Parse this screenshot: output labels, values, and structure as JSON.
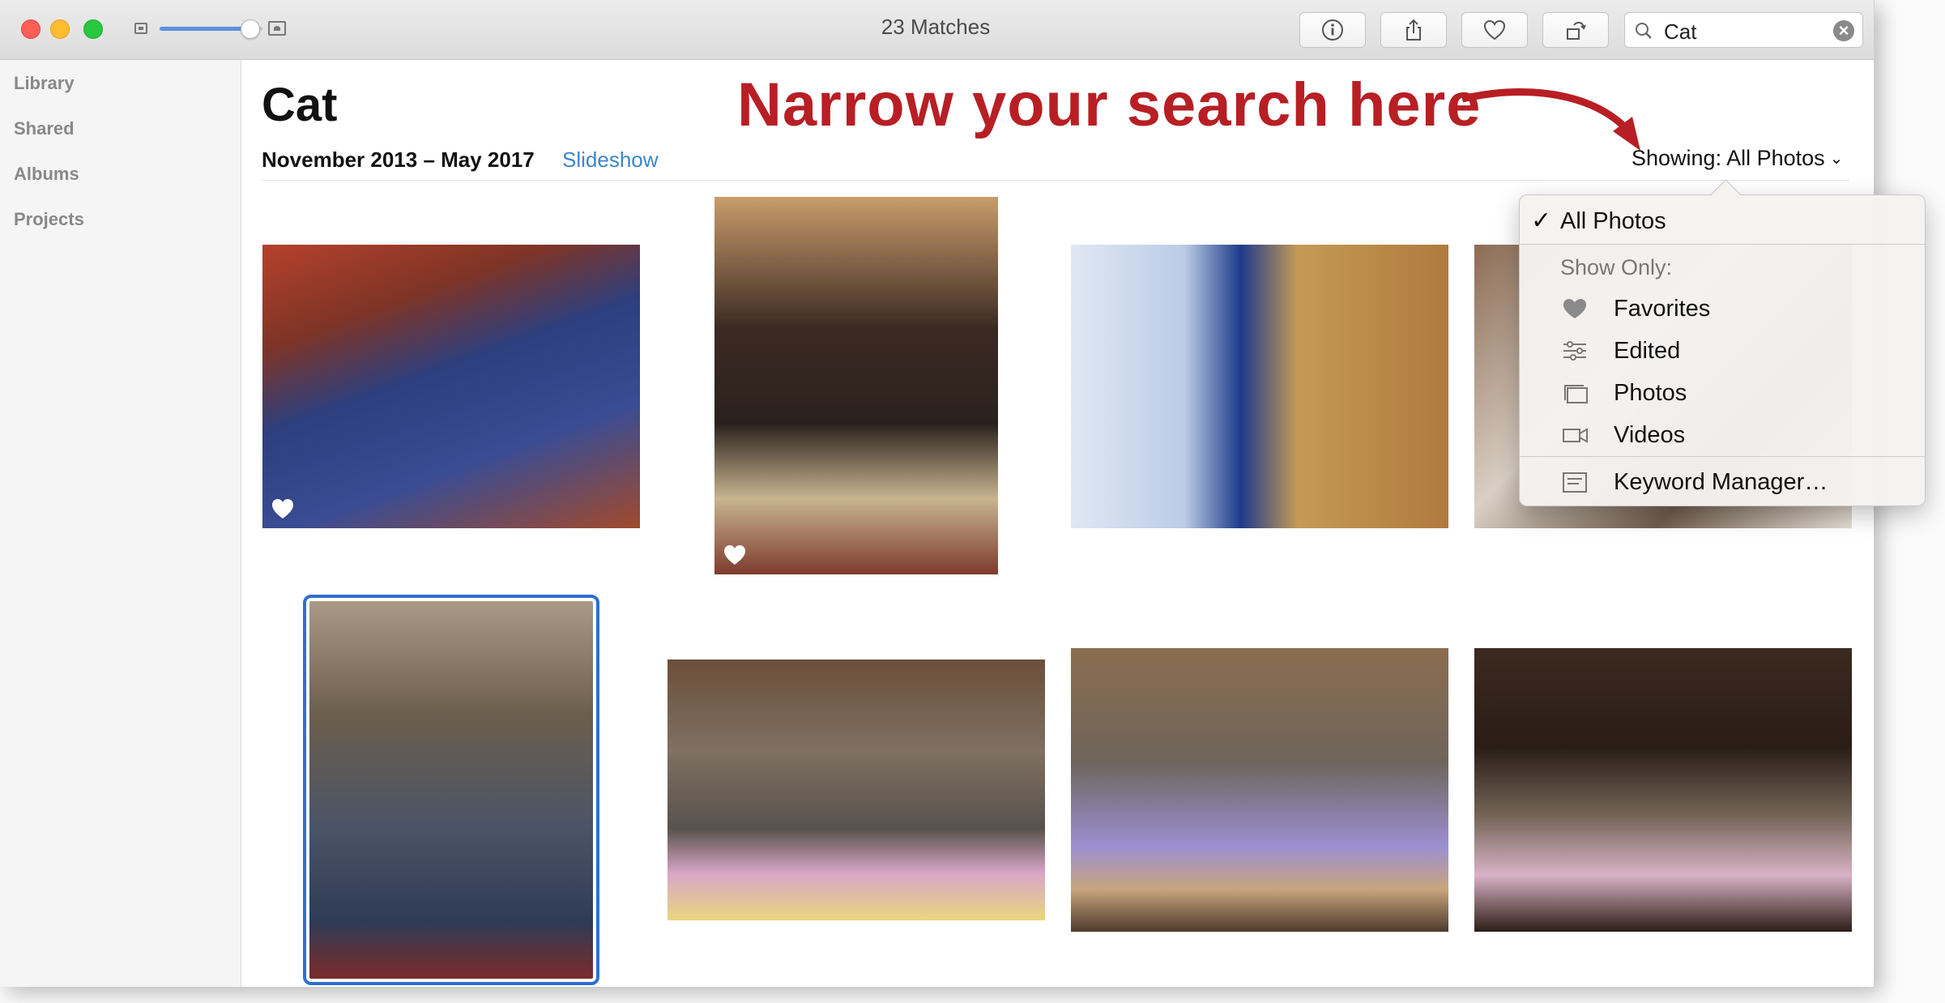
{
  "window": {
    "title": "23 Matches"
  },
  "toolbar": {
    "buttons": [
      "info-icon",
      "share-icon",
      "heart-icon",
      "rotate-icon"
    ],
    "search": {
      "value": "Cat",
      "icon": "search-icon"
    }
  },
  "sidebar": {
    "items": [
      {
        "label": "Library"
      },
      {
        "label": "Shared"
      },
      {
        "label": "Albums"
      },
      {
        "label": "Projects"
      }
    ]
  },
  "main": {
    "title": "Cat",
    "date_range": "November 2013 – May 2017",
    "slideshow_label": "Slideshow",
    "showing_label": "Showing: All Photos",
    "annotation": "Narrow your search here",
    "annotation_color": "#b71f24"
  },
  "menu": {
    "checked": "All Photos",
    "section_header": "Show Only:",
    "options": [
      {
        "label": "Favorites",
        "icon": "heart-icon"
      },
      {
        "label": "Edited",
        "icon": "sliders-icon"
      },
      {
        "label": "Photos",
        "icon": "photos-stack-icon"
      },
      {
        "label": "Videos",
        "icon": "video-camera-icon"
      }
    ],
    "footer": {
      "label": "Keyword Manager…",
      "icon": "keyword-icon"
    }
  },
  "photos": [
    {
      "favorite": true,
      "selected": false
    },
    {
      "favorite": true,
      "selected": false
    },
    {
      "favorite": false,
      "selected": false
    },
    {
      "favorite": false,
      "selected": false
    },
    {
      "favorite": false,
      "selected": true
    },
    {
      "favorite": false,
      "selected": false
    },
    {
      "favorite": false,
      "selected": false
    },
    {
      "favorite": false,
      "selected": false
    }
  ],
  "colors": {
    "accent": "#2e6fd0",
    "link": "#3c86c6"
  }
}
